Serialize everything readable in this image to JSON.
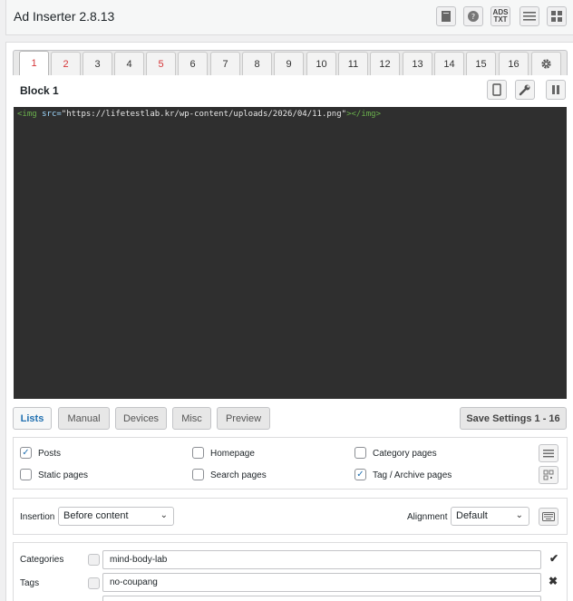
{
  "app": {
    "title": "Ad Inserter 2.8.13"
  },
  "header_icons": [
    "book-icon",
    "help-icon",
    "ads-txt-icon",
    "list-icon",
    "grid-icon"
  ],
  "header": {
    "ads_txt_label": "ADS\nTXT"
  },
  "tabs": [
    "1",
    "2",
    "3",
    "4",
    "5",
    "6",
    "7",
    "8",
    "9",
    "10",
    "11",
    "12",
    "13",
    "14",
    "15",
    "16"
  ],
  "block": {
    "title": "Block 1"
  },
  "code": {
    "open_tag": "<img",
    "attr": " src=",
    "value": "\"https://lifetestlab.kr/wp-content/uploads/2026/04/11.png\"",
    "close_tag": "></img>"
  },
  "buttons": {
    "lists": "Lists",
    "manual": "Manual",
    "devices": "Devices",
    "misc": "Misc",
    "preview": "Preview",
    "save": "Save Settings 1 - 16"
  },
  "pages": {
    "posts": {
      "label": "Posts",
      "checked": true
    },
    "homepage": {
      "label": "Homepage",
      "checked": false
    },
    "category": {
      "label": "Category pages",
      "checked": false
    },
    "static": {
      "label": "Static pages",
      "checked": false
    },
    "search": {
      "label": "Search pages",
      "checked": false
    },
    "tag_archive": {
      "label": "Tag / Archive pages",
      "checked": true
    }
  },
  "insertion": {
    "label": "Insertion",
    "value": "Before content"
  },
  "alignment": {
    "label": "Alignment",
    "value": "Default"
  },
  "filters": {
    "categories": {
      "label": "Categories",
      "value": "mind-body-lab"
    },
    "tags": {
      "label": "Tags",
      "value": "no-coupang"
    }
  },
  "colors": {
    "accent": "#2271b1",
    "red_tab": "#d63638",
    "editor_bg": "#2f2f2f"
  }
}
